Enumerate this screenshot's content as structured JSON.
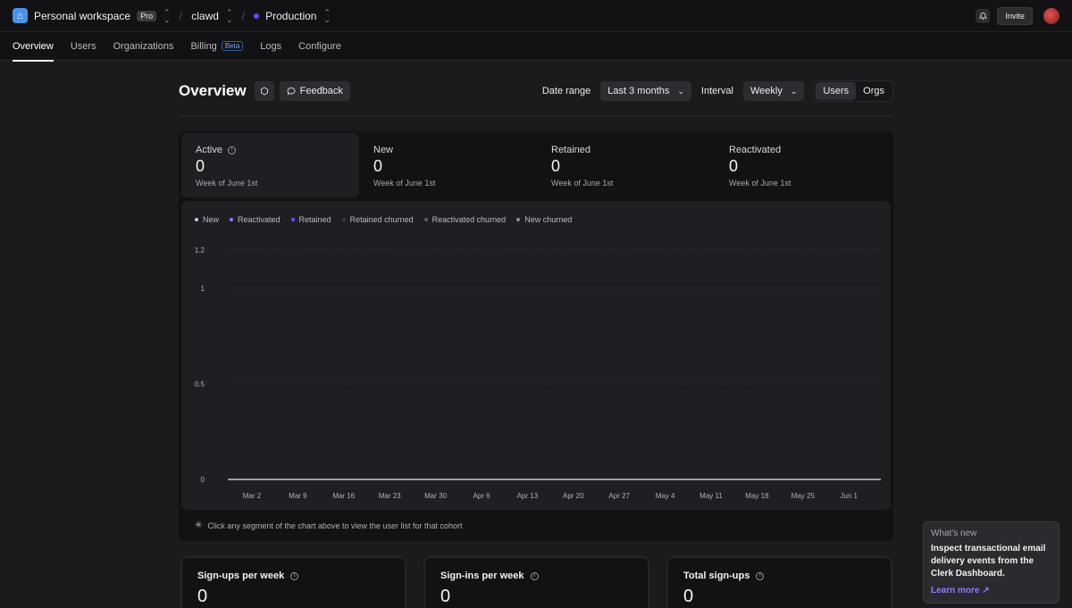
{
  "topbar": {
    "workspace": "Personal workspace",
    "plan_badge": "Pro",
    "app": "clawd",
    "environment": "Production",
    "invite_label": "Invite"
  },
  "nav": {
    "items": [
      {
        "label": "Overview",
        "active": true
      },
      {
        "label": "Users"
      },
      {
        "label": "Organizations"
      },
      {
        "label": "Billing",
        "badge": "Beta"
      },
      {
        "label": "Logs"
      },
      {
        "label": "Configure"
      }
    ]
  },
  "header": {
    "title": "Overview",
    "feedback_label": "Feedback",
    "date_range_label": "Date range",
    "date_range_value": "Last 3 months",
    "interval_label": "Interval",
    "interval_value": "Weekly",
    "toggle": [
      "Users",
      "Orgs"
    ],
    "toggle_selected": "Users"
  },
  "stats": [
    {
      "name": "Active",
      "value": "0",
      "sub": "Week of June 1st",
      "selected": true
    },
    {
      "name": "New",
      "value": "0",
      "sub": "Week of June 1st"
    },
    {
      "name": "Retained",
      "value": "0",
      "sub": "Week of June 1st"
    },
    {
      "name": "Reactivated",
      "value": "0",
      "sub": "Week of June 1st"
    }
  ],
  "legend": [
    {
      "name": "New",
      "color": "#c9c4ff"
    },
    {
      "name": "Reactivated",
      "color": "#8b7cff"
    },
    {
      "name": "Retained",
      "color": "#6c47ff"
    },
    {
      "name": "Retained churned",
      "color": "#3a3a40"
    },
    {
      "name": "Reactivated churned",
      "color": "#5a5a60"
    },
    {
      "name": "New churned",
      "color": "#8a8a90"
    }
  ],
  "chart_data": {
    "type": "bar",
    "categories": [
      "Mar 2",
      "Mar 9",
      "Mar 16",
      "Mar 23",
      "Mar 30",
      "Apr 6",
      "Apr 13",
      "Apr 20",
      "Apr 27",
      "May 4",
      "May 11",
      "May 18",
      "May 25",
      "Jun 1"
    ],
    "series": [
      {
        "name": "New",
        "values": [
          0,
          0,
          0,
          0,
          0,
          0,
          0,
          0,
          0,
          0,
          0,
          0,
          0,
          0
        ]
      },
      {
        "name": "Reactivated",
        "values": [
          0,
          0,
          0,
          0,
          0,
          0,
          0,
          0,
          0,
          0,
          0,
          0,
          0,
          0
        ]
      },
      {
        "name": "Retained",
        "values": [
          0,
          0,
          0,
          0,
          0,
          0,
          0,
          0,
          0,
          0,
          0,
          0,
          0,
          0
        ]
      },
      {
        "name": "Retained churned",
        "values": [
          0,
          0,
          0,
          0,
          0,
          0,
          0,
          0,
          0,
          0,
          0,
          0,
          0,
          0
        ]
      },
      {
        "name": "Reactivated churned",
        "values": [
          0,
          0,
          0,
          0,
          0,
          0,
          0,
          0,
          0,
          0,
          0,
          0,
          0,
          0
        ]
      },
      {
        "name": "New churned",
        "values": [
          0,
          0,
          0,
          0,
          0,
          0,
          0,
          0,
          0,
          0,
          0,
          0,
          0,
          0
        ]
      }
    ],
    "yticks": [
      "0",
      "0.5",
      "1",
      "1.2"
    ],
    "ylim": [
      0,
      1.2
    ],
    "grid": true,
    "legend_position": "top-left"
  },
  "chart_footnote": "Click any segment of the chart above to view the user list for that cohort",
  "bottom_cards": [
    {
      "name": "Sign-ups per week",
      "value": "0"
    },
    {
      "name": "Sign-ins per week",
      "value": "0"
    },
    {
      "name": "Total sign-ups",
      "value": "0"
    }
  ],
  "whats_new": {
    "heading": "What's new",
    "body": "Inspect transactional email delivery events from the Clerk Dashboard.",
    "link": "Learn more"
  },
  "icons": {
    "logo": "clerk-logo-icon",
    "bell": "bell-icon",
    "settings": "hexagon-icon",
    "feedback": "speech-bubble-icon",
    "info": "info-icon"
  }
}
